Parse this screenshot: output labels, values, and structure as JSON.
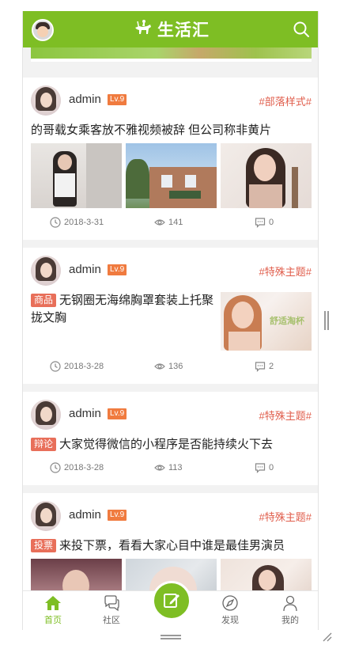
{
  "app": {
    "logo_text": "生活汇"
  },
  "colors": {
    "brand": "#7ebe24",
    "topic": "#e05d4b",
    "level": "#f07b3f",
    "badge": "#e86f5a"
  },
  "posts": [
    {
      "username": "admin",
      "level": "Lv.9",
      "topic": "#部落样式#",
      "title": "的哥载女乘客放不雅视频被辞 但公司称非黄片",
      "date": "2018-3-31",
      "views": "141",
      "comments": "0"
    },
    {
      "username": "admin",
      "level": "Lv.9",
      "topic": "#特殊主题#",
      "badge": "商品",
      "title": "无钢圈无海绵胸罩套装上托聚拢文胸",
      "date": "2018-3-28",
      "views": "136",
      "comments": "2",
      "image_caption": "舒适淘杯"
    },
    {
      "username": "admin",
      "level": "Lv.9",
      "topic": "#特殊主题#",
      "badge": "辩论",
      "title": "大家觉得微信的小程序是否能持续火下去",
      "date": "2018-3-28",
      "views": "113",
      "comments": "0"
    },
    {
      "username": "admin",
      "level": "Lv.9",
      "topic": "#特殊主题#",
      "badge": "投票",
      "title": "来投下票，看看大家心目中谁是最佳男演员"
    }
  ],
  "tabbar": {
    "home": "首页",
    "community": "社区",
    "find": "发现",
    "me": "我的"
  }
}
